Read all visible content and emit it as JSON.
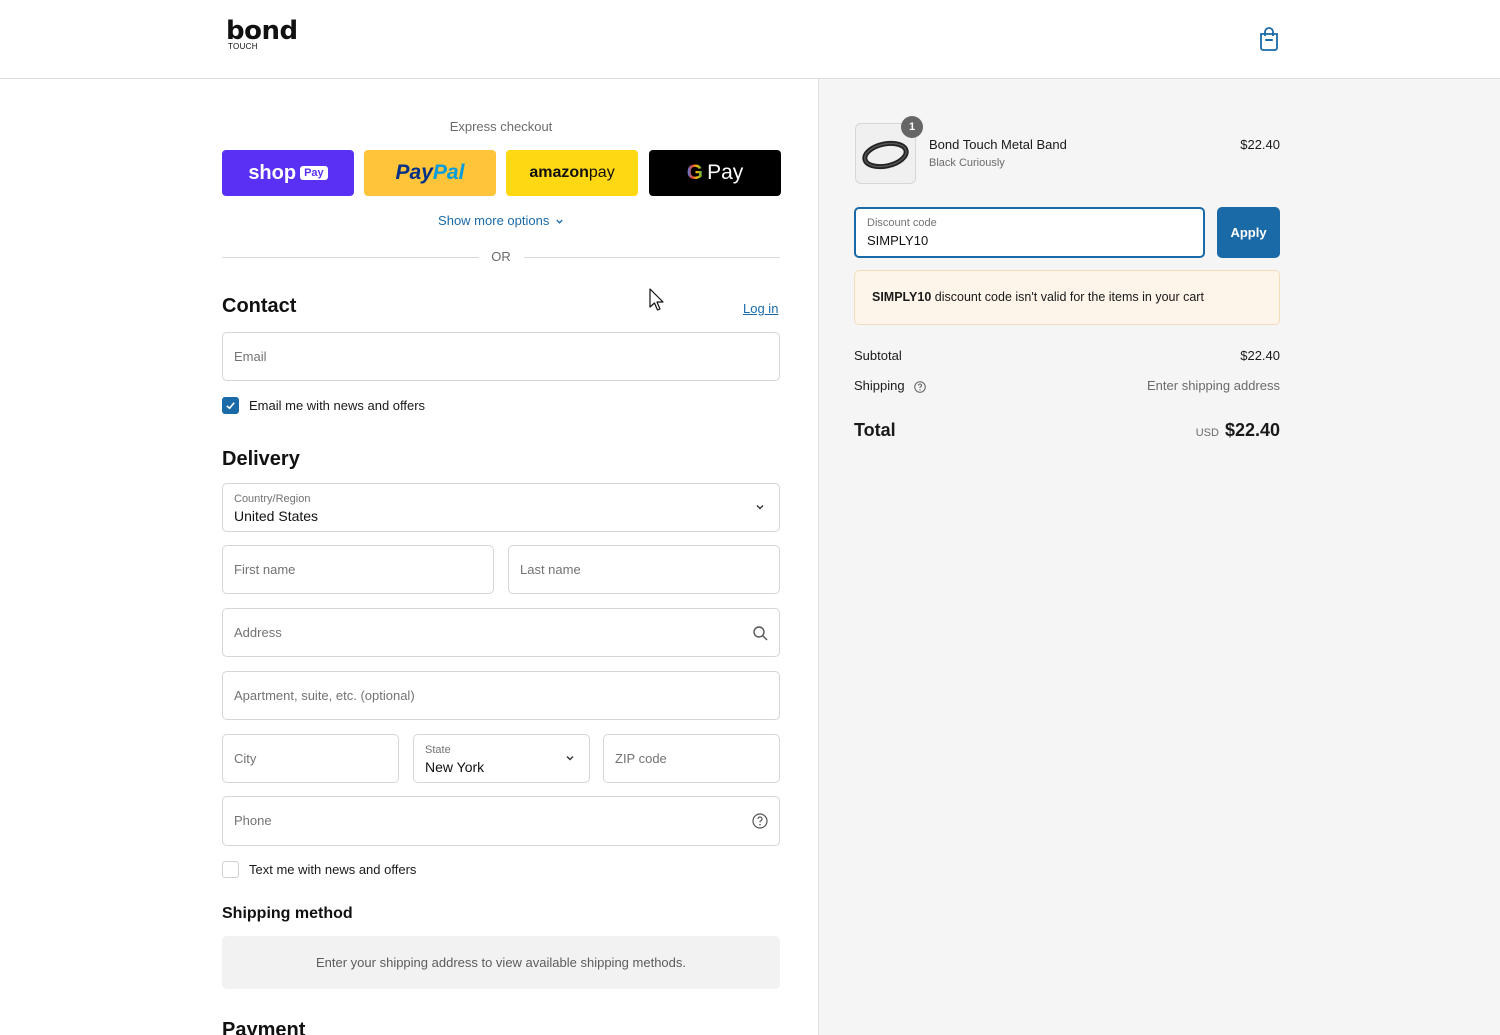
{
  "brand": {
    "name": "bond",
    "sub": "TOUCH"
  },
  "express": {
    "title": "Express checkout",
    "shop_pay": {
      "shop": "shop",
      "pay": "Pay",
      "color": "#5a31f4"
    },
    "paypal": {
      "p1": "Pay",
      "p2": "Pal",
      "color": "#ffc439"
    },
    "amazon": {
      "a": "amazon",
      "b": " pay",
      "color": "#ffd814"
    },
    "gpay": {
      "g": "G",
      "pay": "Pay",
      "color": "#000000"
    },
    "more_options": "Show more options",
    "or": "OR"
  },
  "contact": {
    "title": "Contact",
    "login": "Log in",
    "email_placeholder": "Email",
    "email_news": "Email me with news and offers",
    "email_news_checked": true
  },
  "delivery": {
    "title": "Delivery",
    "country_label": "Country/Region",
    "country_value": "United States",
    "first_name": "First name",
    "last_name": "Last name",
    "address": "Address",
    "apartment": "Apartment, suite, etc. (optional)",
    "city": "City",
    "state_label": "State",
    "state_value": "New York",
    "zip": "ZIP code",
    "phone": "Phone",
    "text_news": "Text me with news and offers",
    "text_news_checked": false
  },
  "shipping_method": {
    "title": "Shipping method",
    "message": "Enter your shipping address to view available shipping methods."
  },
  "payment": {
    "title": "Payment"
  },
  "order": {
    "item": {
      "name": "Bond Touch Metal Band",
      "variant": "Black Curiously",
      "price": "$22.40",
      "qty": "1"
    },
    "discount_label": "Discount code",
    "discount_value": "SIMPLY10",
    "apply": "Apply",
    "alert_code": "SIMPLY10",
    "alert_text": " discount code isn't valid for the items in your cart",
    "subtotal_label": "Subtotal",
    "subtotal_value": "$22.40",
    "shipping_label": "Shipping",
    "shipping_value": "Enter shipping address",
    "total_label": "Total",
    "total_currency": "USD",
    "total_value": "$22.40"
  },
  "colors": {
    "accent": "#1a6aa8",
    "alert_bg": "#fdf5ea",
    "panel_bg": "#f5f5f5"
  }
}
